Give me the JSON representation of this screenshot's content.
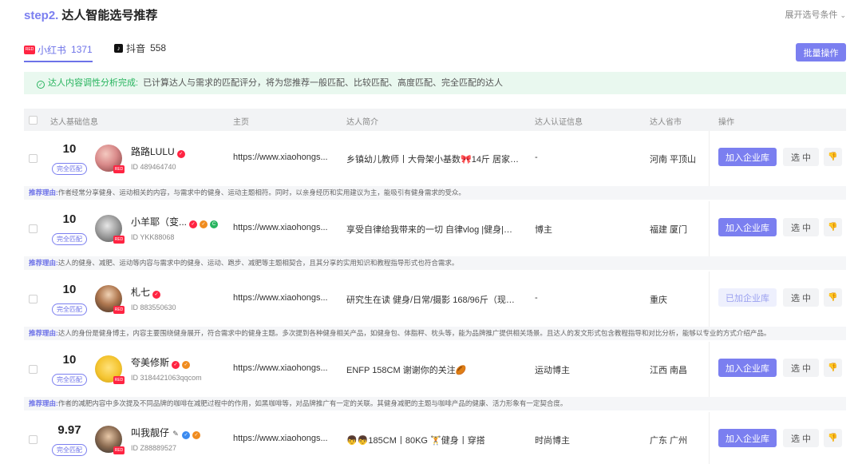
{
  "header": {
    "step": "step2.",
    "title": "达人智能选号推荐",
    "expand_label": "展开选号条件",
    "expand_icon": "chevron-down-icon"
  },
  "tabs": [
    {
      "label": "小红书",
      "count": "1371",
      "logo": "RED",
      "active": true
    },
    {
      "label": "抖音",
      "count": "558",
      "logo": "♪",
      "active": false
    }
  ],
  "batch_label": "批量操作",
  "notice": {
    "title": "达人内容调性分析完成:",
    "text": "已计算达人与需求的匹配评分，将为您推荐一般匹配、比较匹配、高度匹配、完全匹配的达人"
  },
  "columns": [
    "达人基础信息",
    "主页",
    "达人简介",
    "达人认证信息",
    "达人省市",
    "操作"
  ],
  "reason_label": "推荐理由:",
  "rows": [
    {
      "score": "10",
      "match": "完全匹配",
      "name": "路路LULU",
      "id": "ID 489464740",
      "home": "https://www.xiaohongs...",
      "intro": "乡镇幼儿教师丨大骨架小基数🎀14斤 居家运动...",
      "cert": "-",
      "loc": "河南 平顶山",
      "add": "加入企业库",
      "pick": "选 中",
      "reason": "作者经常分享健身、运动相关的内容，与需求中的健身、运动主题相符。同时，以亲身经历和实用建议为主，能吸引有健身需求的受众。"
    },
    {
      "score": "10",
      "match": "完全匹配",
      "name": "小羊耶（变...",
      "id": "ID YKK88068",
      "home": "https://www.xiaohongs...",
      "intro": "享受自律给我带来的一切 自律vlog |健身|护肤...",
      "cert": "博主",
      "loc": "福建 厦门",
      "add": "加入企业库",
      "pick": "选 中",
      "reason": "达人的健身、减肥、运动等内容与需求中的健身、运动、跑步、减肥等主题相契合，且其分享的实用知识和教程指导形式也符合需求。"
    },
    {
      "score": "10",
      "match": "完全匹配",
      "name": "札七",
      "id": "ID 883550630",
      "home": "https://www.xiaohongs...",
      "intro": "研究生在读 健身/日常/摄影 168/96斤（现在1...",
      "cert": "-",
      "loc": "重庆",
      "add": "已加企业库",
      "pick": "选 中",
      "reason": "达人的身份是健身博主，内容主要围绕健身展开，符合需求中的健身主题。多次提到各种健身相关产品，如健身包、体脂秤、枕头等，能为品牌推广提供相关场景。且达人的发文形式包含教程指导和对比分析，能够以专业的方式介绍产品。"
    },
    {
      "score": "10",
      "match": "完全匹配",
      "name": "夸美修斯",
      "id": "ID 3184421063qqcom",
      "home": "https://www.xiaohongs...",
      "intro": "ENFP 158CM 谢谢你的关注🏉",
      "cert": "运动博主",
      "loc": "江西 南昌",
      "add": "加入企业库",
      "pick": "选 中",
      "reason": "作者的减肥内容中多次提及不同品牌的咖啡在减肥过程中的作用，如黑咖啡等，对品牌推广有一定的关联。其健身减肥的主题与咖啡产品的健康、活力形象有一定契合度。"
    },
    {
      "score": "9.97",
      "match": "完全匹配",
      "name": "叫我靓仔",
      "id": "ID Z88889527",
      "home": "https://www.xiaohongs...",
      "intro": "👦👦185CM丨80KG 🏋健身丨穿搭",
      "cert": "时尚博主",
      "loc": "广东 广州",
      "add": "加入企业库",
      "pick": "选 中",
      "reason": ""
    }
  ],
  "colors": {
    "accent": "#7b7ff0",
    "success": "#27b45e",
    "brand_red": "#ff2442"
  }
}
